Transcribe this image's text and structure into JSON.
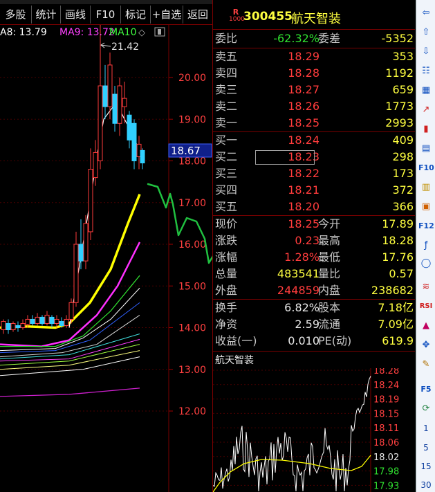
{
  "toolbar": {
    "buttons": [
      "多股",
      "统计",
      "画线",
      "F10",
      "标记",
      "+自选",
      "返回"
    ]
  },
  "legend": {
    "ma8": "A8: 13.79",
    "ma9": "MA9: 13.72",
    "ma10": "MA10"
  },
  "chart_data": {
    "type": "line",
    "price_axis_ticks": [
      "20.00",
      "19.00",
      "18.00",
      "17.00",
      "16.00",
      "15.00",
      "14.00",
      "13.00",
      "12.00"
    ],
    "current_price_tag": "18.67",
    "high_annotation": "21.42",
    "colors": {
      "up": "#ff3c3c",
      "down": "#30d0ff",
      "ma_yellow": "#ffff00",
      "ma_magenta": "#ff00ff",
      "hand_drawn": "#20c040"
    }
  },
  "stock": {
    "badge_top": "R",
    "badge_bottom": "1000",
    "code": "300455",
    "name": "航天智装"
  },
  "order_ratio": {
    "label": "委比",
    "value": "-62.32%",
    "label2": "委差",
    "value2": "-5352"
  },
  "asks": [
    {
      "label": "卖五",
      "price": "18.29",
      "vol": "353"
    },
    {
      "label": "卖四",
      "price": "18.28",
      "vol": "1192"
    },
    {
      "label": "卖三",
      "price": "18.27",
      "vol": "659"
    },
    {
      "label": "卖二",
      "price": "18.26",
      "vol": "1773"
    },
    {
      "label": "卖一",
      "price": "18.25",
      "vol": "2993"
    }
  ],
  "bids": [
    {
      "label": "买一",
      "price": "18.24",
      "vol": "409"
    },
    {
      "label": "买二",
      "price": "18.23",
      "vol": "298"
    },
    {
      "label": "买三",
      "price": "18.22",
      "vol": "173"
    },
    {
      "label": "买四",
      "price": "18.21",
      "vol": "372"
    },
    {
      "label": "买五",
      "price": "18.20",
      "vol": "366"
    }
  ],
  "stats": [
    {
      "l1": "现价",
      "v1": "18.25",
      "c1": "red",
      "l2": "今开",
      "v2": "17.89",
      "c2": "green"
    },
    {
      "l1": "涨跌",
      "v1": "0.23",
      "c1": "red",
      "l2": "最高",
      "v2": "18.28",
      "c2": "red"
    },
    {
      "l1": "涨幅",
      "v1": "1.28%",
      "c1": "red",
      "l2": "最低",
      "v2": "17.76",
      "c2": "green"
    },
    {
      "l1": "总量",
      "v1": "483541",
      "c1": "yellow",
      "l2": "量比",
      "v2": "0.57",
      "c2": "green"
    },
    {
      "l1": "外盘",
      "v1": "244859",
      "c1": "red",
      "l2": "内盘",
      "v2": "238682",
      "c2": "green"
    }
  ],
  "fundamentals": [
    {
      "l1": "换手",
      "v1": "6.82%",
      "l2": "股本",
      "v2": "7.18亿"
    },
    {
      "l1": "净资",
      "v1": "2.59",
      "l2": "流通",
      "v2": "7.09亿"
    },
    {
      "l1": "收益(一)",
      "v1": "0.010",
      "l2": "PE(动)",
      "v2": "619.9"
    }
  ],
  "mini_chart": {
    "title": "航天智装",
    "ticks": [
      "18.28",
      "18.24",
      "18.19",
      "18.15",
      "18.11",
      "18.06",
      "18.02",
      "17.98",
      "17.93"
    ]
  },
  "sidebar": {
    "numbers": [
      "1",
      "5",
      "15",
      "30"
    ]
  }
}
